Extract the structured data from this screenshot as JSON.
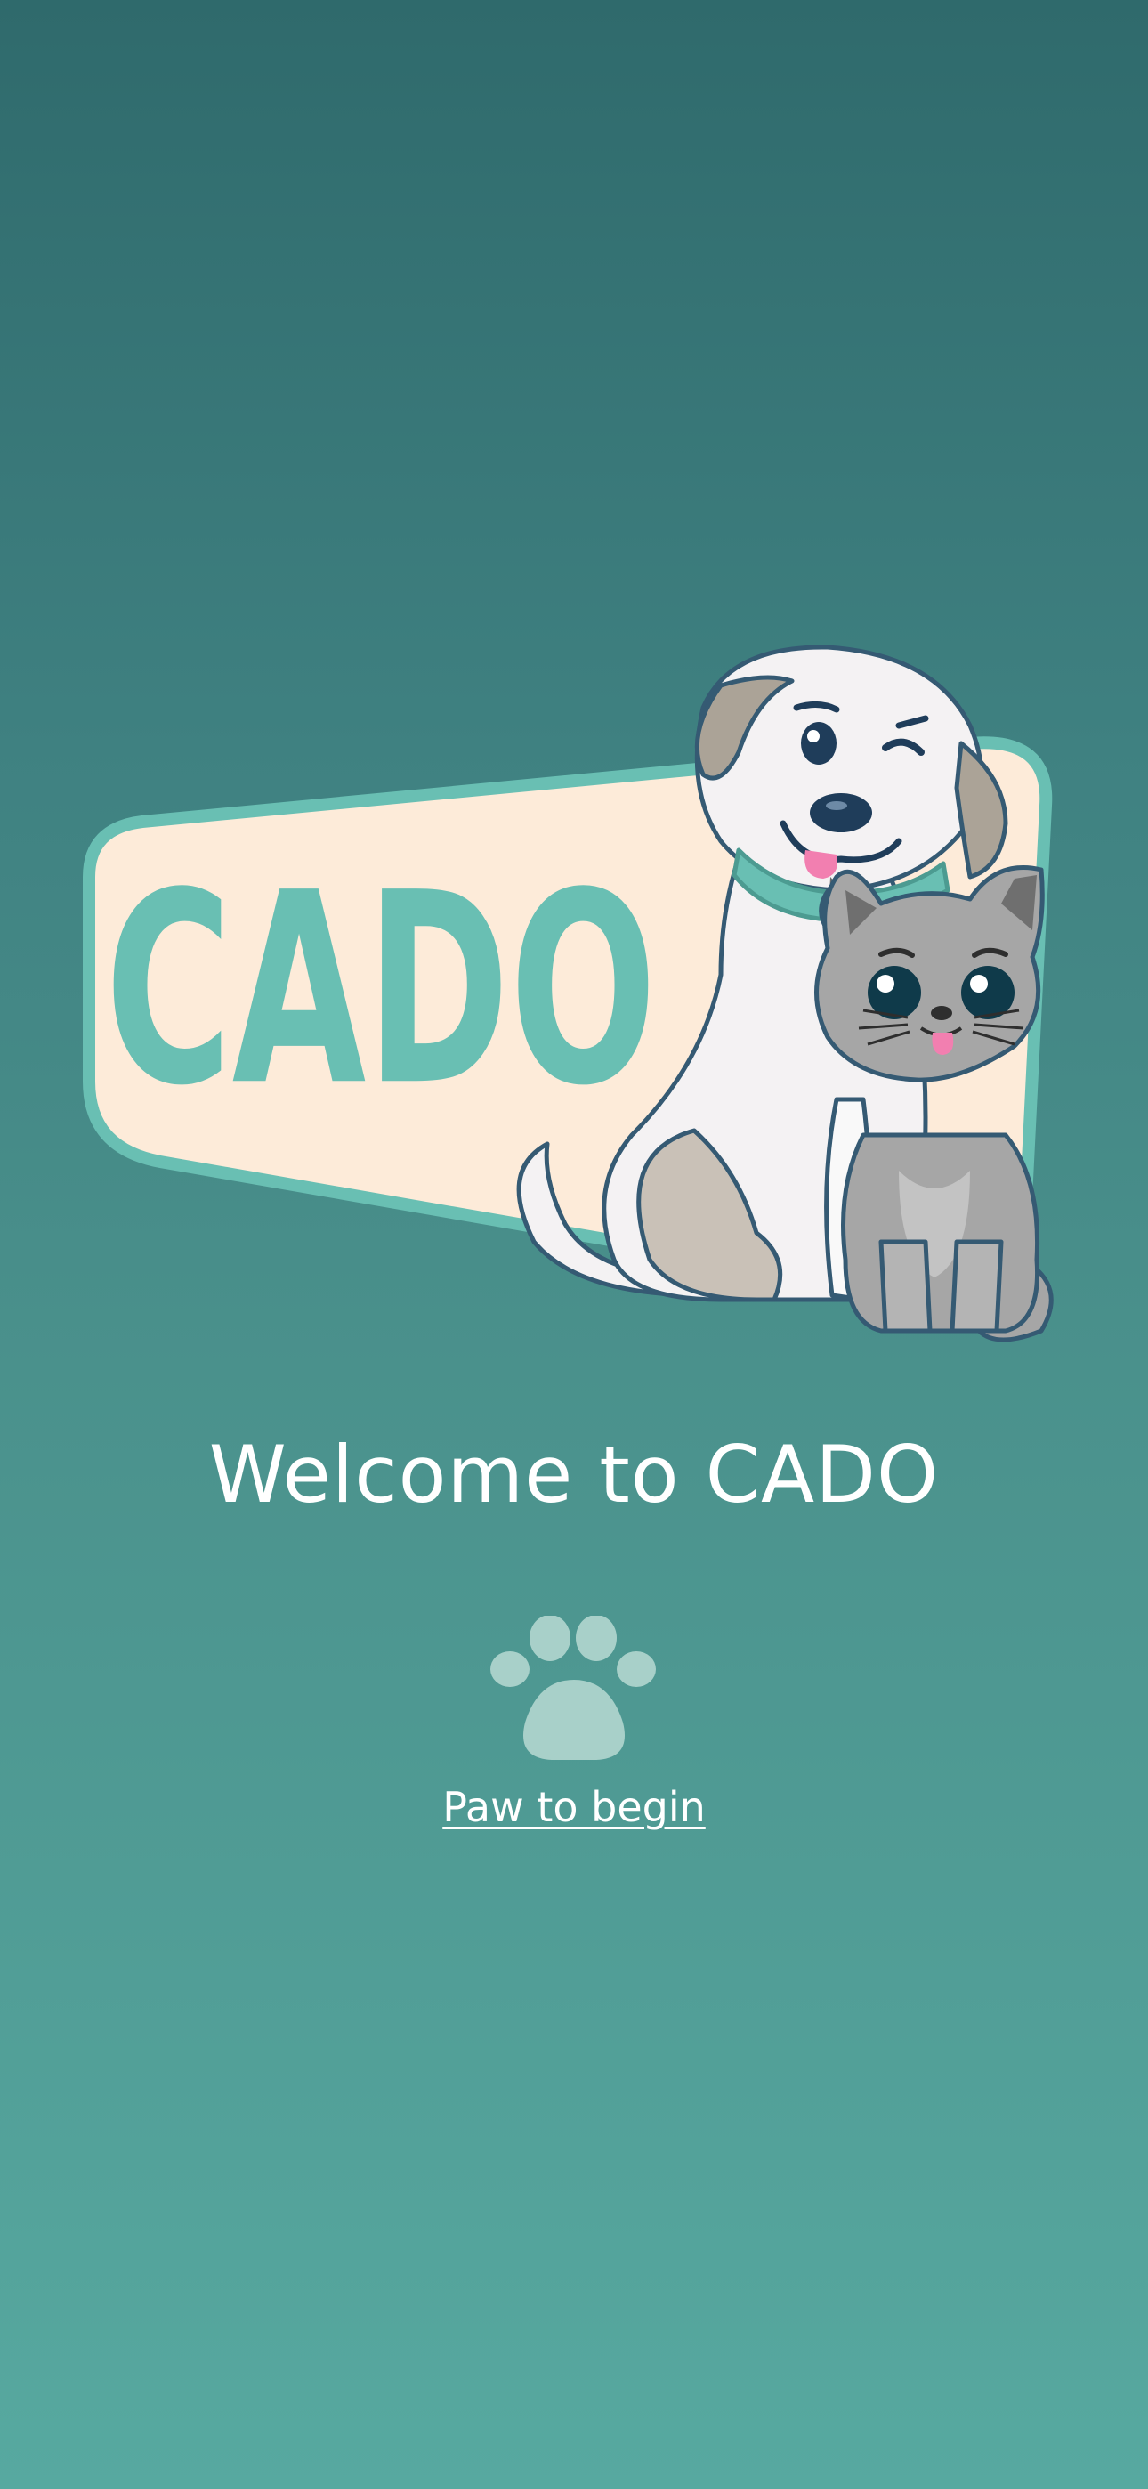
{
  "logo": {
    "wordmark": "CADO",
    "icon": "dog-and-cat-logo"
  },
  "welcome": {
    "title": "Welcome to CADO"
  },
  "cta": {
    "icon": "paw-icon",
    "label": "Paw to begin"
  },
  "colors": {
    "background_top": "#2f6a6c",
    "background_bottom": "#57a9a0",
    "accent_teal": "#69bfb3",
    "badge_cream": "#fdebd9",
    "paw": "#a8d0c9",
    "text": "#ffffff"
  }
}
